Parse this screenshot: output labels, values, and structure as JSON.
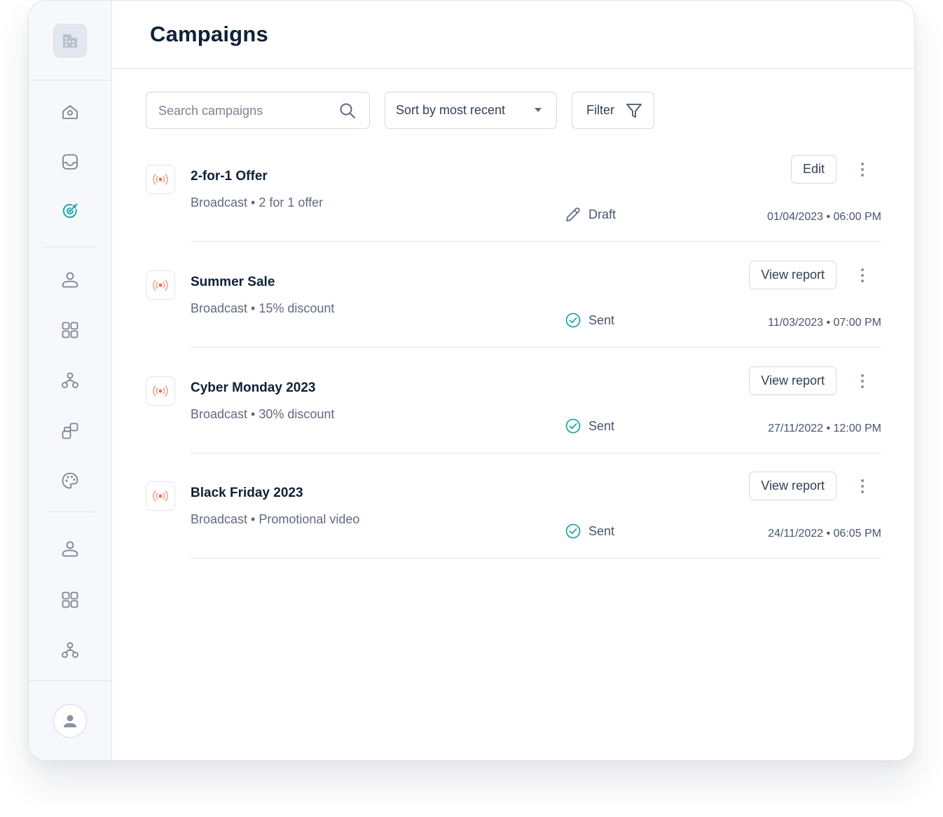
{
  "page": {
    "title": "Campaigns"
  },
  "sidebar": {
    "logo_icon": "building-icon",
    "items": [
      {
        "name": "home",
        "icon": "home-icon",
        "active": false
      },
      {
        "name": "inbox",
        "icon": "inbox-icon",
        "active": false
      },
      {
        "name": "campaigns",
        "icon": "target-icon",
        "active": true
      },
      {
        "name": "contacts",
        "icon": "user-icon",
        "active": false
      },
      {
        "name": "apps",
        "icon": "grid-icon",
        "active": false
      },
      {
        "name": "flows",
        "icon": "hierarchy-icon",
        "active": false
      },
      {
        "name": "integrations",
        "icon": "blocks-icon",
        "active": false
      },
      {
        "name": "appearance",
        "icon": "palette-icon",
        "active": false
      },
      {
        "name": "profile",
        "icon": "user-icon",
        "active": false
      },
      {
        "name": "dashboard",
        "icon": "grid-icon",
        "active": false
      },
      {
        "name": "organization",
        "icon": "hierarchy-icon",
        "active": false
      }
    ],
    "avatar_icon": "avatar-icon"
  },
  "toolbar": {
    "search_placeholder": "Search campaigns",
    "sort_label": "Sort by most recent",
    "filter_label": "Filter"
  },
  "campaigns": [
    {
      "name": "2-for-1 Offer",
      "subtitle": "Broadcast • 2 for 1 offer",
      "status": "Draft",
      "status_icon": "pencil-icon",
      "datetime": "01/04/2023 • 06:00 PM",
      "action": "Edit"
    },
    {
      "name": "Summer Sale",
      "subtitle": "Broadcast • 15% discount",
      "status": "Sent",
      "status_icon": "check-circle-icon",
      "datetime": "11/03/2023 • 07:00 PM",
      "action": "View report"
    },
    {
      "name": "Cyber Monday 2023",
      "subtitle": "Broadcast • 30% discount",
      "status": "Sent",
      "status_icon": "check-circle-icon",
      "datetime": "27/11/2022 • 12:00 PM",
      "action": "View report"
    },
    {
      "name": "Black Friday 2023",
      "subtitle": "Broadcast • Promotional video",
      "status": "Sent",
      "status_icon": "check-circle-icon",
      "datetime": "24/11/2022 • 06:05 PM",
      "action": "View report"
    }
  ],
  "colors": {
    "accent": "#1fa7a8",
    "broadcast_icon": "#f0836b",
    "title": "#0f2137",
    "muted": "#5f6b7d"
  }
}
